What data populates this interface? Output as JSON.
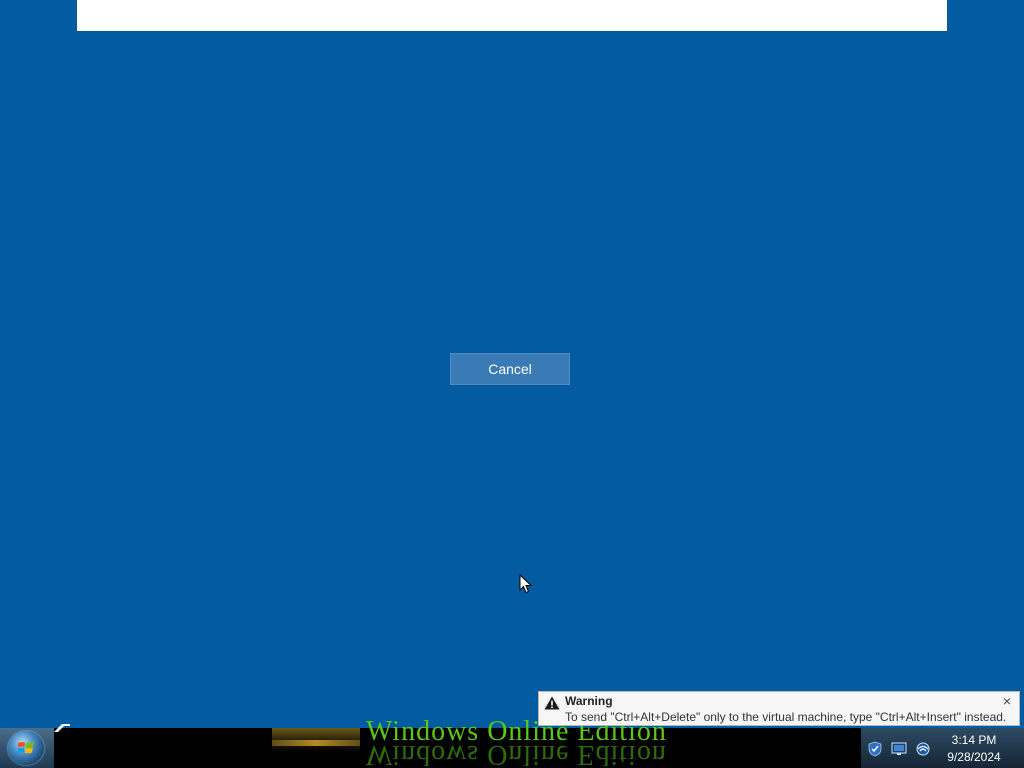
{
  "dialog": {
    "cancel_label": "Cancel"
  },
  "taskbar": {
    "banner_text": "Windows Online Edition",
    "clock_time": "3:14 PM",
    "clock_date": "9/28/2024",
    "tray_icons": [
      "shield-icon",
      "monitor-icon",
      "network-icon"
    ]
  },
  "notification": {
    "title": "Warning",
    "message": "To send \"Ctrl+Alt+Delete\" only to the virtual machine, type \"Ctrl+Alt+Insert\" instead.",
    "close_glyph": "×",
    "icon": "warning-icon"
  },
  "colors": {
    "background": "#035ba1",
    "button": "#3a7bb5",
    "banner_text": "#5ac814"
  }
}
